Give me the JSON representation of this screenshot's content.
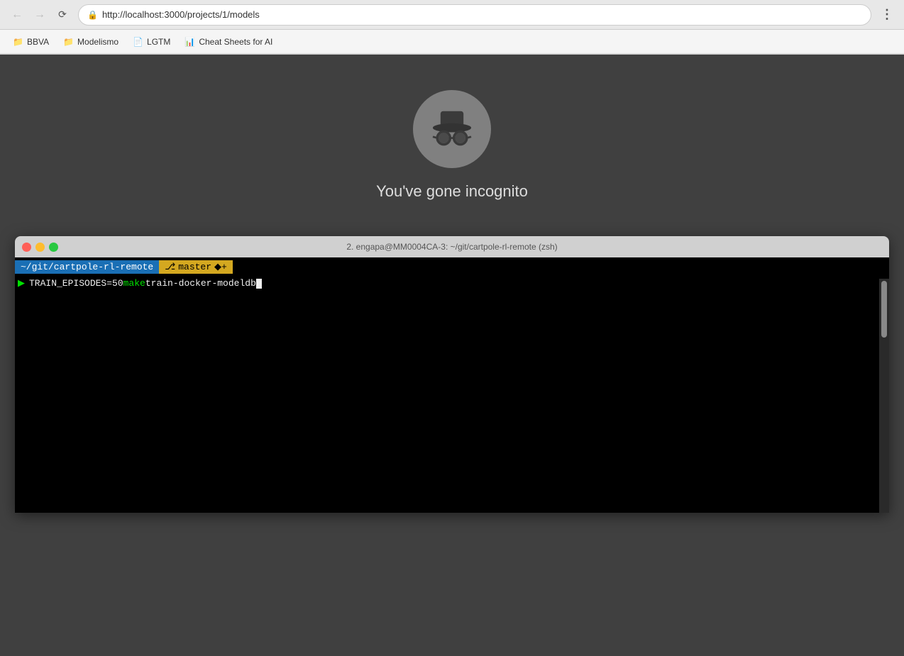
{
  "browser": {
    "url": "http://localhost:3000/projects/1/models",
    "back_disabled": true,
    "forward_disabled": true
  },
  "bookmarks": [
    {
      "id": "bbva",
      "icon": "📁",
      "label": "BBVA"
    },
    {
      "id": "modelismo",
      "icon": "📁",
      "label": "Modelismo"
    },
    {
      "id": "lgtm",
      "icon": "📄",
      "label": "LGTM"
    },
    {
      "id": "cheatsheets",
      "icon": "📊",
      "label": "Cheat Sheets for AI"
    }
  ],
  "incognito": {
    "heading": "You've gone incognito"
  },
  "terminal": {
    "title": "2. engapa@MM0004CA-3: ~/git/cartpole-rl-remote (zsh)",
    "path": "~/git/cartpole-rl-remote",
    "branch": "master",
    "branch_extra": "◆+",
    "prompt_char": "▶",
    "command_env": "TRAIN_EPISODES=50",
    "command_make": "make",
    "command_rest": "train-docker-modeldb"
  }
}
